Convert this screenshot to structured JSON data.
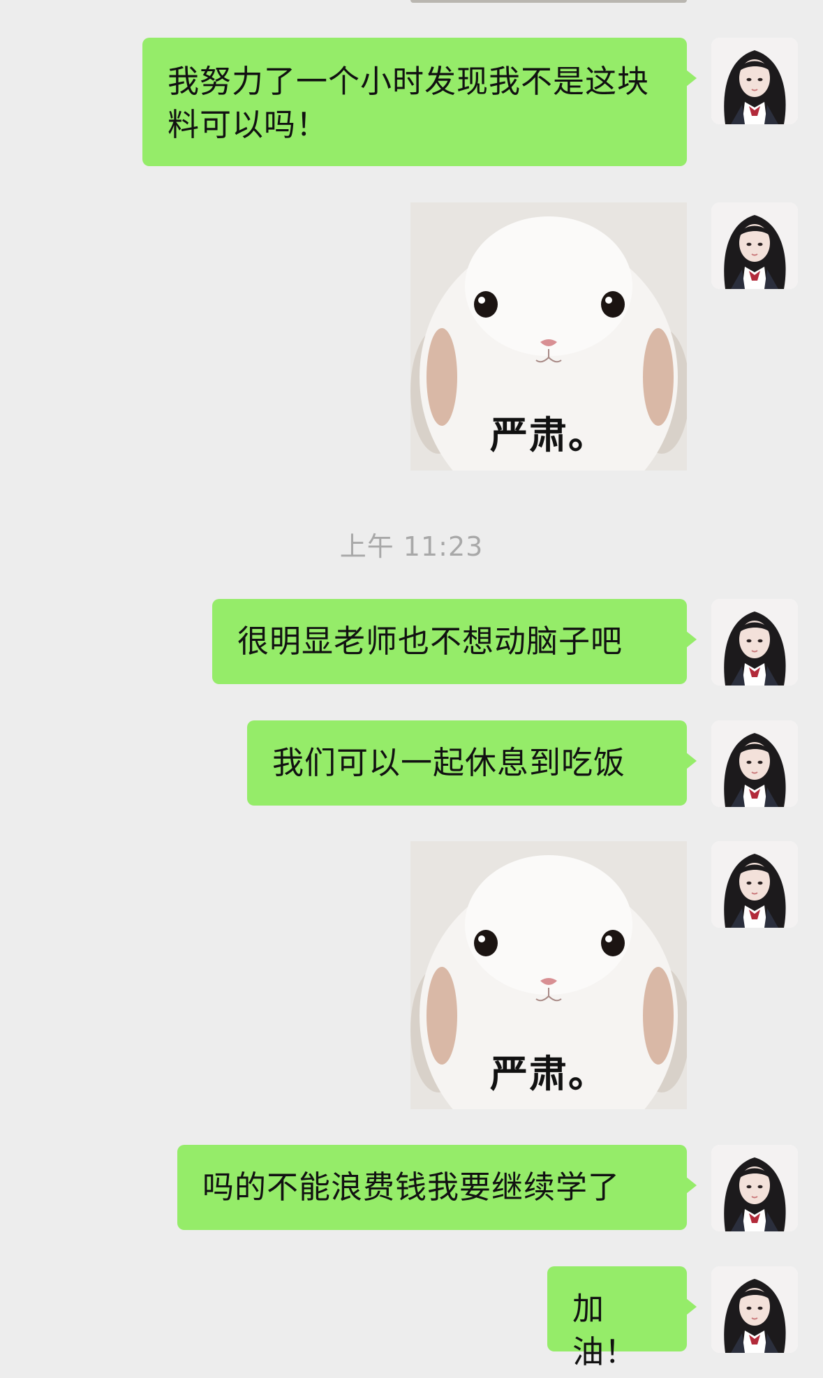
{
  "conversation": {
    "timestamp": "上午 11:23",
    "messages": [
      {
        "type": "text",
        "text": "我努力了一个小时发现我不是这块料可以吗！"
      },
      {
        "type": "sticker",
        "caption": "严肃。",
        "icon": "rabbit-sticker"
      },
      {
        "type": "text",
        "text": "很明显老师也不想动脑子吧"
      },
      {
        "type": "text",
        "text": "我们可以一起休息到吃饭"
      },
      {
        "type": "sticker",
        "caption": "严肃。",
        "icon": "rabbit-sticker"
      },
      {
        "type": "text",
        "text": "吗的不能浪费钱我要继续学了"
      },
      {
        "type": "text",
        "text": "加油！"
      }
    ]
  },
  "colors": {
    "background": "#ededed",
    "bubble_self": "#95ec69",
    "timestamp_text": "#a8a8a8"
  }
}
